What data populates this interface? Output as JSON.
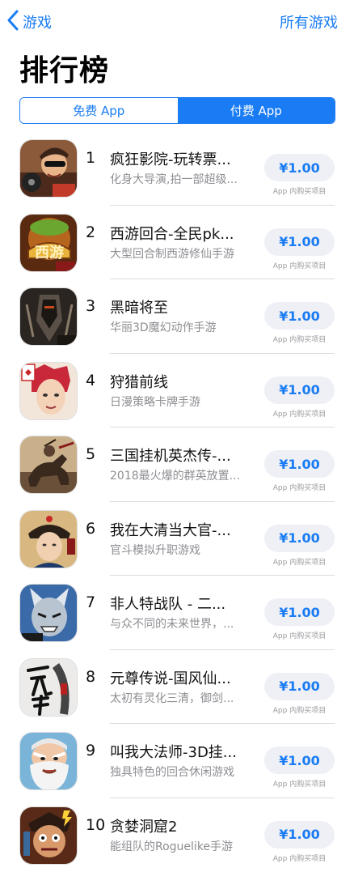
{
  "nav": {
    "back_label": "游戏",
    "right_label": "所有游戏"
  },
  "page_title": "排行榜",
  "segments": {
    "free": "免费 App",
    "paid": "付费 App"
  },
  "apps": [
    {
      "rank": "1",
      "name": "疯狂影院-玩转票...",
      "subtitle": "化身大导演,拍一部超级...",
      "price": "¥1.00",
      "iap": "App 内购买项目",
      "icon": "cinema-game-icon"
    },
    {
      "rank": "2",
      "name": "西游回合-全民pk...",
      "subtitle": "大型回合制西游修仙手游",
      "price": "¥1.00",
      "iap": "App 内购买项目",
      "icon": "xiyou-game-icon"
    },
    {
      "rank": "3",
      "name": "黑暗将至",
      "subtitle": "华丽3D魔幻动作手游",
      "price": "¥1.00",
      "iap": "App 内购买项目",
      "icon": "dark-knight-game-icon"
    },
    {
      "rank": "4",
      "name": "狩猎前线",
      "subtitle": "日漫策略卡牌手游",
      "price": "¥1.00",
      "iap": "App 内购买项目",
      "icon": "hunter-game-icon"
    },
    {
      "rank": "5",
      "name": "三国挂机英杰传-...",
      "subtitle": "2018最火爆的群英放置...",
      "price": "¥1.00",
      "iap": "App 内购买项目",
      "icon": "three-kingdoms-game-icon"
    },
    {
      "rank": "6",
      "name": "我在大清当大官-...",
      "subtitle": "官斗模拟升职游戏",
      "price": "¥1.00",
      "iap": "App 内购买项目",
      "icon": "qing-official-game-icon"
    },
    {
      "rank": "7",
      "name": "非人特战队 - 二...",
      "subtitle": "与众不同的未来世界，...",
      "price": "¥1.00",
      "iap": "App 内购买项目",
      "icon": "mech-squad-game-icon"
    },
    {
      "rank": "8",
      "name": "元尊传说-国风仙...",
      "subtitle": "太初有灵化三清，御剑...",
      "price": "¥1.00",
      "iap": "App 内购买项目",
      "icon": "yuanzun-game-icon"
    },
    {
      "rank": "9",
      "name": "叫我大法师-3D挂...",
      "subtitle": "独具特色的回合休闲游戏",
      "price": "¥1.00",
      "iap": "App 内购买项目",
      "icon": "wizard-game-icon"
    },
    {
      "rank": "10",
      "name": "贪婪洞窟2",
      "subtitle": "能组队的Roguelike手游",
      "price": "¥1.00",
      "iap": "App 内购买项目",
      "icon": "greedy-cave-game-icon"
    }
  ],
  "colors": {
    "accent": "#1a7cf4",
    "button_bg": "#eff0f6",
    "secondary_text": "#8e8e93"
  }
}
